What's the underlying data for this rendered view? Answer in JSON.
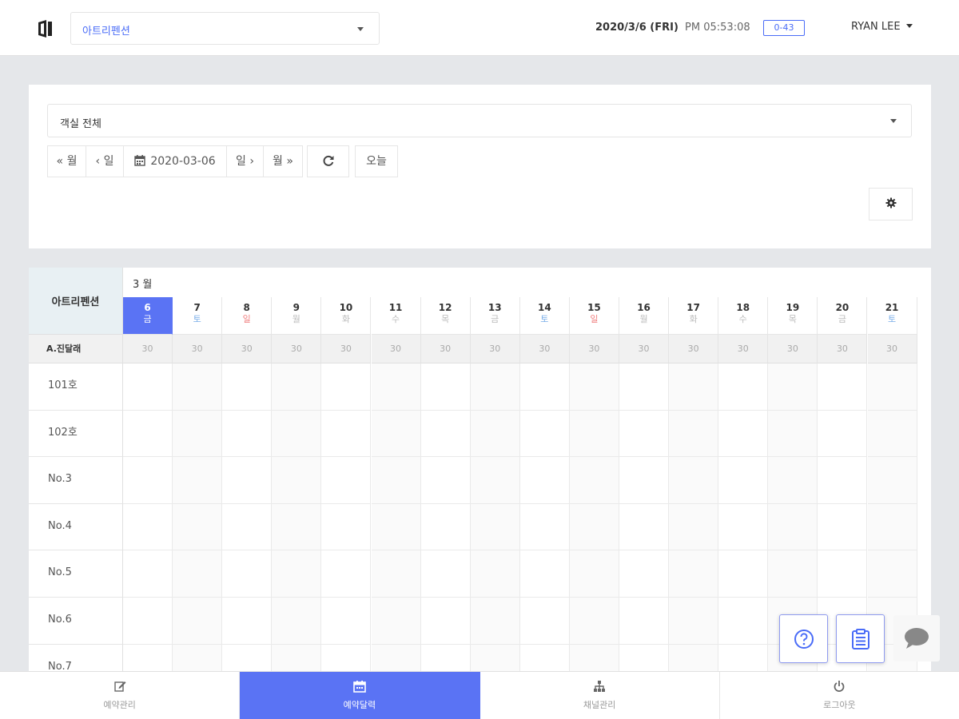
{
  "header": {
    "property_select": "아트리펜션",
    "date": "2020/3/6 (FRI)",
    "time": "PM 05:53:08",
    "badge": "0-43",
    "user": "RYAN LEE"
  },
  "filter": {
    "room_select": "객실 전체",
    "prev_month": "« 월",
    "prev_day": "‹ 일",
    "current_date": "2020-03-06",
    "next_day": "일 ›",
    "next_month": "월 »",
    "today": "오늘"
  },
  "calendar": {
    "property_name": "아트리펜션",
    "month_label": "3 월",
    "days": [
      {
        "num": "6",
        "name": "금",
        "kind": "today"
      },
      {
        "num": "7",
        "name": "토",
        "kind": "sat"
      },
      {
        "num": "8",
        "name": "일",
        "kind": "sun"
      },
      {
        "num": "9",
        "name": "월",
        "kind": ""
      },
      {
        "num": "10",
        "name": "화",
        "kind": ""
      },
      {
        "num": "11",
        "name": "수",
        "kind": ""
      },
      {
        "num": "12",
        "name": "목",
        "kind": ""
      },
      {
        "num": "13",
        "name": "금",
        "kind": ""
      },
      {
        "num": "14",
        "name": "토",
        "kind": "sat"
      },
      {
        "num": "15",
        "name": "일",
        "kind": "sun"
      },
      {
        "num": "16",
        "name": "월",
        "kind": ""
      },
      {
        "num": "17",
        "name": "화",
        "kind": ""
      },
      {
        "num": "18",
        "name": "수",
        "kind": ""
      },
      {
        "num": "19",
        "name": "목",
        "kind": ""
      },
      {
        "num": "20",
        "name": "금",
        "kind": ""
      },
      {
        "num": "21",
        "name": "토",
        "kind": "sat"
      }
    ],
    "room_type": "A.진달래",
    "availability": [
      "30",
      "30",
      "30",
      "30",
      "30",
      "30",
      "30",
      "30",
      "30",
      "30",
      "30",
      "30",
      "30",
      "30",
      "30",
      "30"
    ],
    "rooms": [
      "101호",
      "102호",
      "No.3",
      "No.4",
      "No.5",
      "No.6",
      "No.7"
    ]
  },
  "bottom_nav": [
    {
      "label": "예약관리",
      "icon": "edit-icon",
      "active": false
    },
    {
      "label": "예약달력",
      "icon": "calendar-icon",
      "active": true
    },
    {
      "label": "채널관리",
      "icon": "sitemap-icon",
      "active": false
    },
    {
      "label": "로그아웃",
      "icon": "power-icon",
      "active": false
    }
  ],
  "floating": {
    "help_icon": "help-icon",
    "notes_icon": "clipboard-icon",
    "chat_icon": "chat-icon"
  },
  "colors": {
    "accent": "#5a73f4",
    "link": "#4a6cf7",
    "saturday": "#7aaee8",
    "sunday": "#ef7d7d"
  }
}
